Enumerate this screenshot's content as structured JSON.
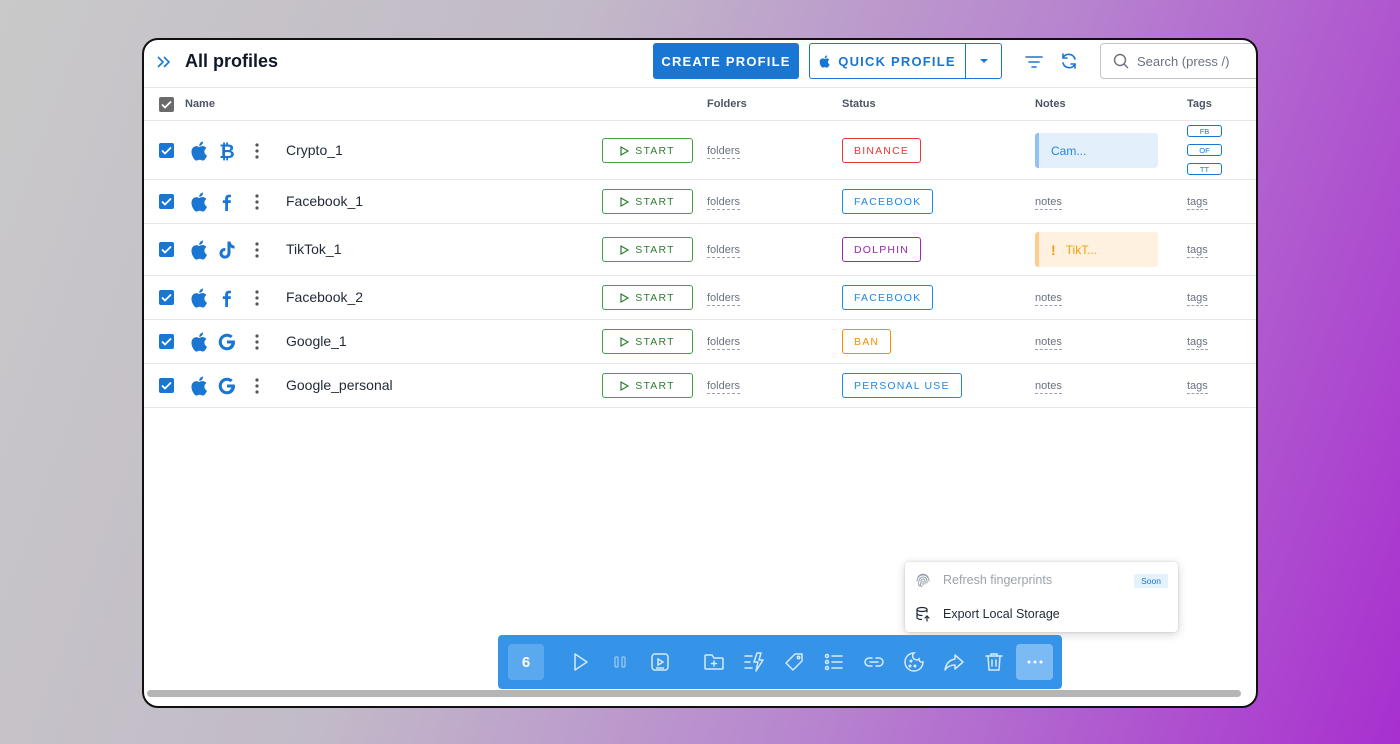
{
  "header": {
    "title": "All profiles",
    "create_label": "CREATE PROFILE",
    "quick_label": "QUICK PROFILE",
    "search_placeholder": "Search (press /)"
  },
  "columns": {
    "name": "Name",
    "folders": "Folders",
    "status": "Status",
    "notes": "Notes",
    "tags": "Tags"
  },
  "start_label": "START",
  "profiles": [
    {
      "name": "Crypto_1",
      "os": "apple-icon",
      "brand": "bitcoin-icon",
      "folders": "folders",
      "status": "BINANCE",
      "status_color": "#e53935",
      "note": "Cam...",
      "note_type": "info",
      "tags": [
        "FB",
        "OF",
        "TT"
      ]
    },
    {
      "name": "Facebook_1",
      "os": "apple-icon",
      "brand": "facebook-icon",
      "folders": "folders",
      "status": "FACEBOOK",
      "status_color": "#1e88e5",
      "note": "notes",
      "tags_text": "tags"
    },
    {
      "name": "TikTok_1",
      "os": "apple-icon",
      "brand": "tiktok-icon",
      "folders": "folders",
      "status": "DOLPHIN",
      "status_color": "#9c27b0",
      "note": "TikT...",
      "note_type": "warning",
      "tags_text": "tags"
    },
    {
      "name": "Facebook_2",
      "os": "apple-icon",
      "brand": "facebook-icon",
      "folders": "folders",
      "status": "FACEBOOK",
      "status_color": "#1e88e5",
      "note": "notes",
      "tags_text": "tags"
    },
    {
      "name": "Google_1",
      "os": "apple-icon",
      "brand": "google-icon",
      "folders": "folders",
      "status": "BAN",
      "status_color": "#fb8c00",
      "note": "notes",
      "tags_text": "tags"
    },
    {
      "name": "Google_personal",
      "os": "apple-icon",
      "brand": "google-icon",
      "folders": "folders",
      "status": "PERSONAL USE",
      "status_color": "#1e88e5",
      "note": "notes",
      "tags_text": "tags"
    }
  ],
  "context_menu": {
    "refresh_label": "Refresh fingerprints",
    "soon_label": "Soon",
    "export_label": "Export Local Storage"
  },
  "action_bar": {
    "selected_count": "6",
    "icons": [
      "play-icon",
      "pause-icon",
      "video-icon",
      "folder-add-icon",
      "magic-icon",
      "tag-icon",
      "list-icon",
      "link-icon",
      "cookie-icon",
      "share-icon",
      "trash-icon",
      "more-icon"
    ]
  },
  "colors": {
    "accent": "#1976d2",
    "start_green": "#43a047",
    "action_bar": "#3593e8"
  }
}
